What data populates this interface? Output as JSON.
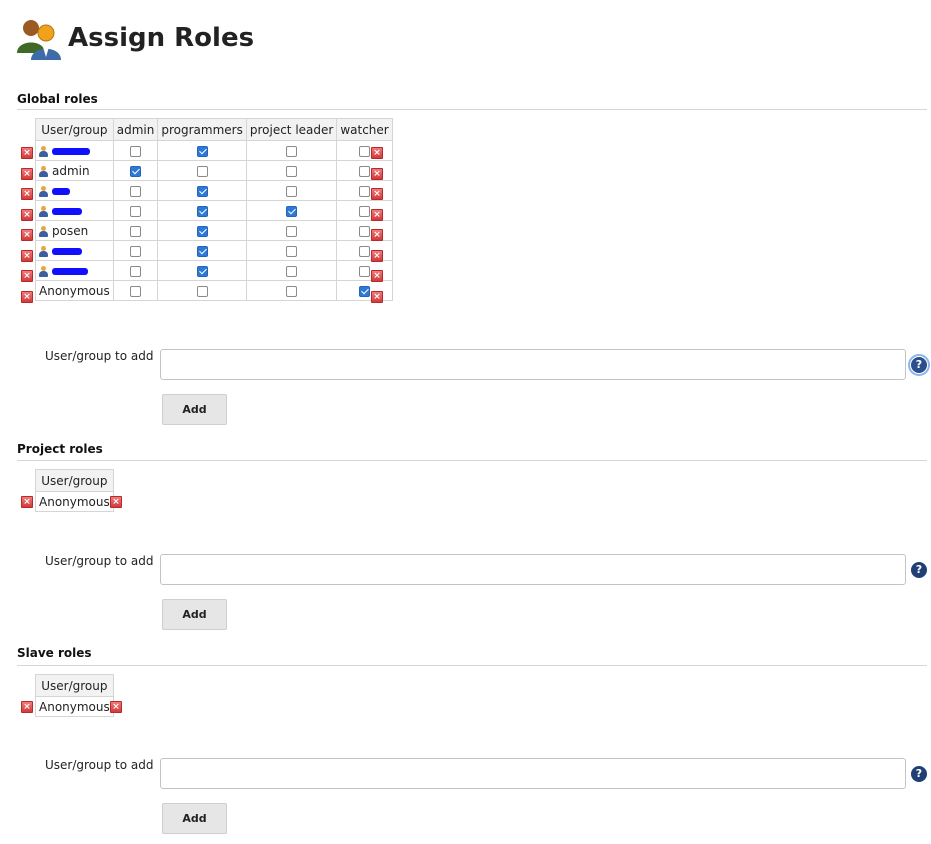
{
  "page": {
    "title": "Assign Roles"
  },
  "global": {
    "title": "Global roles",
    "headers": [
      "User/group",
      "admin",
      "programmers",
      "project leader",
      "watcher"
    ],
    "rows": [
      {
        "name": "",
        "redacted": true,
        "icon": "user-icon",
        "checks": [
          false,
          true,
          false,
          false
        ]
      },
      {
        "name": "admin",
        "redacted": false,
        "icon": "user-icon",
        "checks": [
          true,
          false,
          false,
          false
        ]
      },
      {
        "name": "",
        "redacted": true,
        "icon": "user-icon",
        "checks": [
          false,
          true,
          false,
          false
        ]
      },
      {
        "name": "",
        "redacted": true,
        "icon": "user-icon",
        "checks": [
          false,
          true,
          true,
          false
        ]
      },
      {
        "name": "posen",
        "redacted": false,
        "icon": "user-icon",
        "checks": [
          false,
          true,
          false,
          false
        ]
      },
      {
        "name": "",
        "redacted": true,
        "icon": "user-icon",
        "checks": [
          false,
          true,
          false,
          false
        ]
      },
      {
        "name": "",
        "redacted": true,
        "icon": "user-icon",
        "checks": [
          false,
          true,
          false,
          false
        ]
      },
      {
        "name": "Anonymous",
        "redacted": false,
        "icon": null,
        "checks": [
          false,
          false,
          false,
          true
        ]
      }
    ],
    "add_label": "User/group to add",
    "add_value": "",
    "add_button": "Add"
  },
  "project": {
    "title": "Project roles",
    "header": "User/group",
    "row": "Anonymous",
    "add_label": "User/group to add",
    "add_value": "",
    "add_button": "Add"
  },
  "slave": {
    "title": "Slave roles",
    "header": "User/group",
    "row": "Anonymous",
    "add_label": "User/group to add",
    "add_value": "",
    "add_button": "Add"
  },
  "icons": {
    "header": "assign-roles-icon",
    "help": "help-icon",
    "delete": "delete-icon",
    "user": "user-icon"
  },
  "colors": {
    "checkbox_on": "#2f7ad8",
    "delete": "#d33a3a",
    "help": "#1f3f75",
    "redaction": "#1010ff"
  }
}
